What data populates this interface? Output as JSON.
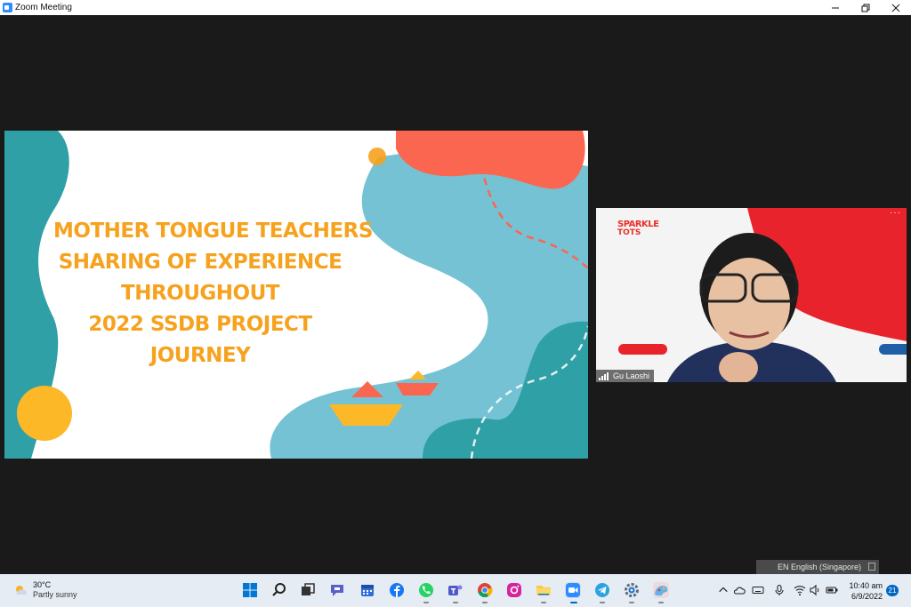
{
  "window": {
    "title": "Zoom Meeting"
  },
  "slide": {
    "title_lines": [
      "MOTHER TONGUE TEACHERS",
      "SHARING OF EXPERIENCE",
      "THROUGHOUT",
      "2022 SSDB PROJECT",
      "JOURNEY"
    ],
    "colors": {
      "teal": "#2fa0a6",
      "light_blue": "#74c2d4",
      "coral": "#fb6650",
      "yellow": "#fdb827",
      "orange_text": "#f6a21e"
    }
  },
  "participant": {
    "name": "Gu Laoshi",
    "logo_line1": "SPARKLE",
    "logo_line2": "TOTS",
    "more_label": "···"
  },
  "language_bar": {
    "text": "EN English (Singapore)"
  },
  "taskbar": {
    "weather_temp": "30°C",
    "weather_desc": "Partly sunny",
    "clock_time": "10:40 am",
    "clock_date": "6/9/2022",
    "notification_count": "21",
    "apps": [
      "start-icon",
      "search-icon",
      "task-view-icon",
      "chat-icon",
      "calendar-icon",
      "facebook-icon",
      "whatsapp-icon",
      "teams-icon",
      "chrome-icon",
      "instagram-icon",
      "file-explorer-icon",
      "zoom-icon",
      "telegram-icon",
      "settings-icon",
      "paint-icon"
    ]
  }
}
